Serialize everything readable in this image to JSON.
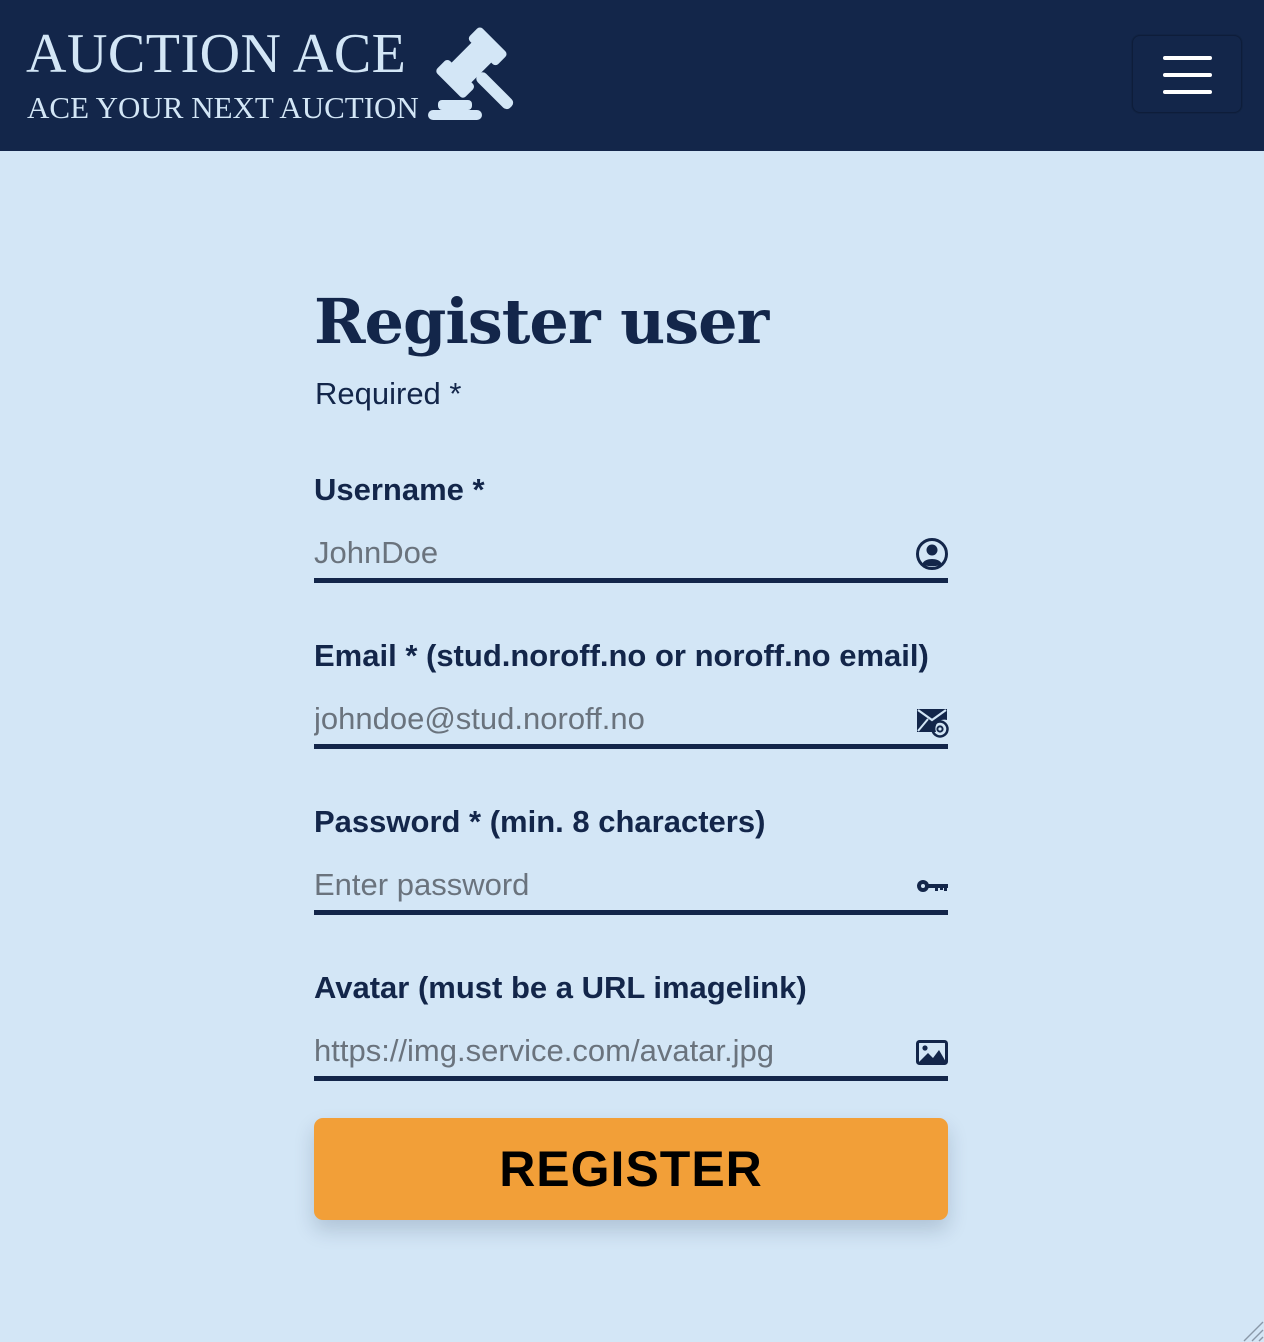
{
  "header": {
    "brand_title": "AUCTION ACE",
    "brand_tagline": "ACE YOUR NEXT AUCTION",
    "logo_icon": "gavel-icon",
    "menu_icon": "hamburger-menu-icon"
  },
  "form": {
    "title": "Register user",
    "required_note": "Required *",
    "fields": {
      "username": {
        "label": "Username *",
        "placeholder": "JohnDoe",
        "icon": "user-circle-icon"
      },
      "email": {
        "label": "Email * (stud.noroff.no or noroff.no email)",
        "placeholder": "johndoe@stud.noroff.no",
        "icon": "envelope-at-icon"
      },
      "password": {
        "label": "Password * (min. 8 characters)",
        "placeholder": "Enter password",
        "icon": "key-icon"
      },
      "avatar": {
        "label": "Avatar (must be a URL imagelink)",
        "placeholder": "https://img.service.com/avatar.jpg",
        "icon": "image-icon"
      }
    },
    "submit_label": "REGISTER"
  },
  "colors": {
    "navy": "#13264a",
    "background": "#d3e6f6",
    "accent": "#f29f38"
  }
}
